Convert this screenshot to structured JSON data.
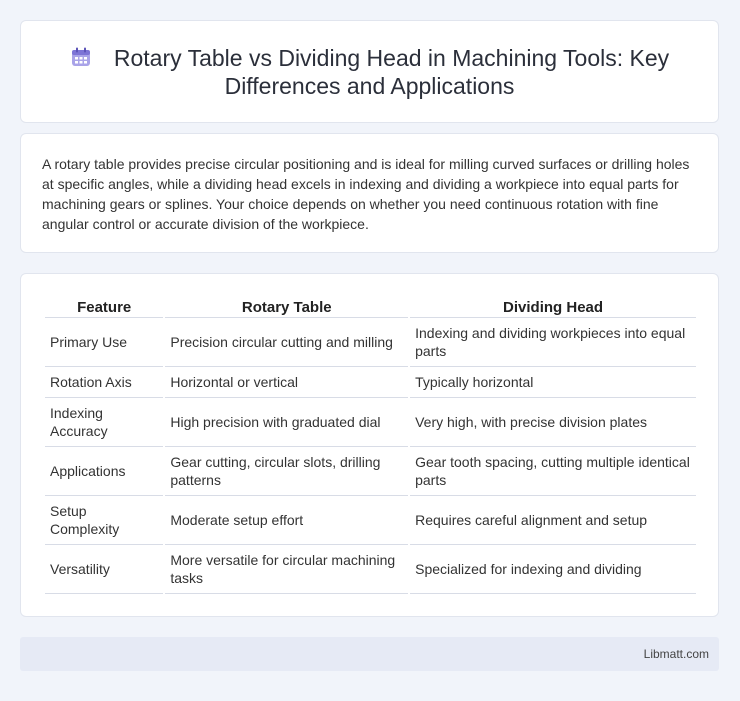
{
  "header": {
    "title": "Rotary Table vs Dividing Head in Machining Tools: Key Differences and Applications",
    "icon": "calendar-icon"
  },
  "intro": {
    "text": "A rotary table provides precise circular positioning and is ideal for milling curved surfaces or drilling holes at specific angles, while a dividing head excels in indexing and dividing a workpiece into equal parts for machining gears or splines. Your choice depends on whether you need continuous rotation with fine angular control or accurate division of the workpiece."
  },
  "table": {
    "headers": [
      "Feature",
      "Rotary Table",
      "Dividing Head"
    ],
    "rows": [
      [
        "Primary Use",
        "Precision circular cutting and milling",
        "Indexing and dividing workpieces into equal parts"
      ],
      [
        "Rotation Axis",
        "Horizontal or vertical",
        "Typically horizontal"
      ],
      [
        "Indexing Accuracy",
        "High precision with graduated dial",
        "Very high, with precise division plates"
      ],
      [
        "Applications",
        "Gear cutting, circular slots, drilling patterns",
        "Gear tooth spacing, cutting multiple identical parts"
      ],
      [
        "Setup Complexity",
        "Moderate setup effort",
        "Requires careful alignment and setup"
      ],
      [
        "Versatility",
        "More versatile for circular machining tasks",
        "Specialized for indexing and dividing"
      ]
    ]
  },
  "footer": {
    "text": "Libmatt.com"
  }
}
